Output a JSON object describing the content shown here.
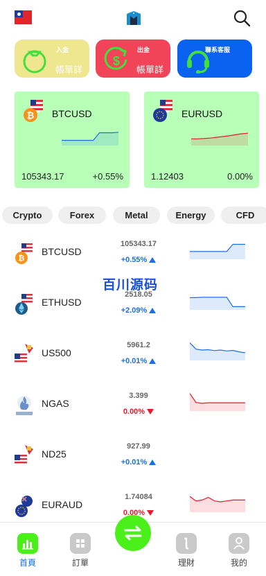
{
  "header": {
    "flag_icon": "taiwan-flag-icon",
    "logo_icon": "app-logo-icon",
    "search_icon": "search-icon"
  },
  "actions": [
    {
      "title": "入金",
      "subtitle": "帳單詳情",
      "icon": "deposit-bag-icon"
    },
    {
      "title": "出金",
      "subtitle": "帳單詳情",
      "icon": "withdraw-dollar-icon"
    },
    {
      "title": "聯系客服",
      "subtitle": "",
      "icon": "customer-service-icon"
    }
  ],
  "featured": [
    {
      "symbol": "BTCUSD",
      "price": "105343.17",
      "change": "+0.55%",
      "trend": "up",
      "spark": [
        0.25,
        0.25,
        0.25,
        0.25,
        0.25,
        0.25,
        0.75,
        0.75,
        0.75,
        0.78
      ],
      "color": "#1a6fe8"
    },
    {
      "symbol": "EURUSD",
      "price": "1.12403",
      "change": "0.00%",
      "trend": "up",
      "spark": [
        0.35,
        0.35,
        0.37,
        0.4,
        0.45,
        0.5,
        0.55,
        0.62,
        0.68,
        0.72
      ],
      "color": "#e8192c"
    }
  ],
  "categories": [
    "Crypto",
    "Forex",
    "Metal",
    "Energy",
    "CFD"
  ],
  "watermark": "百川源码",
  "markets": [
    {
      "symbol": "BTCUSD",
      "price": "105343.17",
      "change": "+0.55%",
      "trend": "up",
      "icon": "btc-usd-icon",
      "spark": [
        0.35,
        0.35,
        0.35,
        0.35,
        0.35,
        0.35,
        0.35,
        0.75,
        0.75,
        0.75
      ]
    },
    {
      "symbol": "ETHUSD",
      "price": "2518.05",
      "change": "+2.09%",
      "trend": "up",
      "icon": "eth-usd-icon",
      "spark": [
        0.6,
        0.6,
        0.62,
        0.62,
        0.62,
        0.62,
        0.62,
        0.1,
        0.1,
        0.1
      ]
    },
    {
      "symbol": "US500",
      "price": "5961.2",
      "change": "+0.01%",
      "trend": "up",
      "icon": "us500-icon",
      "spark": [
        0.9,
        0.55,
        0.5,
        0.52,
        0.47,
        0.5,
        0.45,
        0.48,
        0.4,
        0.35
      ]
    },
    {
      "symbol": "NGAS",
      "price": "3.399",
      "change": "0.00%",
      "trend": "down",
      "icon": "ngas-icon",
      "spark": [
        0.9,
        0.4,
        0.35,
        0.38,
        0.38,
        0.38,
        0.38,
        0.38,
        0.38,
        0.38
      ]
    },
    {
      "symbol": "ND25",
      "price": "927.99",
      "change": "+0.01%",
      "trend": "up",
      "icon": "nd25-icon",
      "spark": []
    },
    {
      "symbol": "EURAUD",
      "price": "1.74084",
      "change": "0.00%",
      "trend": "down",
      "icon": "eur-aud-icon",
      "spark": [
        0.8,
        0.55,
        0.6,
        0.75,
        0.55,
        0.5,
        0.55,
        0.6,
        0.6,
        0.6
      ]
    }
  ],
  "colors": {
    "up": "#1a6fe8",
    "down": "#e8192c",
    "accent_green": "#4bf01a",
    "card_green": "#b8ffb8"
  },
  "bottom_nav": [
    {
      "label": "首頁",
      "icon": "home-chart-icon",
      "active": true
    },
    {
      "label": "訂單",
      "icon": "orders-grid-icon",
      "active": false
    },
    {
      "label": "理財",
      "icon": "finance-icon",
      "active": false
    },
    {
      "label": "我的",
      "icon": "profile-icon",
      "active": false
    }
  ],
  "fab_icon": "swap-arrows-icon"
}
